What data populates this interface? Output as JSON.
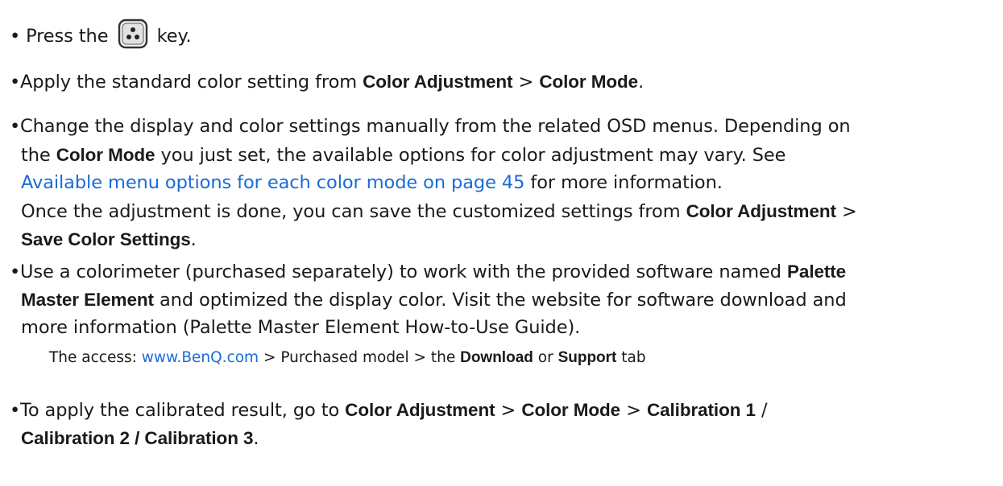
{
  "items": [
    {
      "pre": "Press the",
      "icon": "joystick-key-icon",
      "post": "key."
    },
    {
      "t1": "Apply the standard color setting from ",
      "b1": "Color Adjustment",
      "t2": " > ",
      "b2": "Color Mode",
      "t3": "."
    },
    {
      "l1a": "Change the display and color settings manually from the related OSD menus. Depending on",
      "l2a": "the ",
      "l2b": "Color Mode",
      "l2c": " you just set, the available options for color adjustment may vary. See",
      "link": "Available menu options for each color mode on page 45",
      "l3c": " for more information.",
      "l4a": "Once the adjustment is done, you can save the customized settings from ",
      "l4b": "Color Adjustment",
      "l4c": " >",
      "l5b": "Save Color Settings",
      "l5c": "."
    },
    {
      "l1a": "Use a colorimeter (purchased separately) to work with the provided software named ",
      "l1b": "Palette",
      "l2b": "Master Element",
      "l2c": " and optimized the display color. Visit the website for software download and",
      "l3a": "more information (Palette Master Element How-to-Use Guide)."
    },
    {
      "l1a": "To apply the calibrated result, go to ",
      "l1b": "Color Adjustment",
      "l1c": " > ",
      "l1d": "Color Mode",
      "l1e": " > ",
      "l1f": "Calibration 1",
      "l1g": " /",
      "l2b": "Calibration 2 / Calibration 3",
      "l2c": "."
    }
  ],
  "note": {
    "t1": "The access: ",
    "link": "www.BenQ.com",
    "t2": " > Purchased model > the ",
    "b1": "Download",
    "t3": " or ",
    "b2": "Support",
    "t4": " tab"
  },
  "bullet": "•",
  "colors": {
    "link": "#1a6bd8",
    "text": "#1a1a1a"
  }
}
